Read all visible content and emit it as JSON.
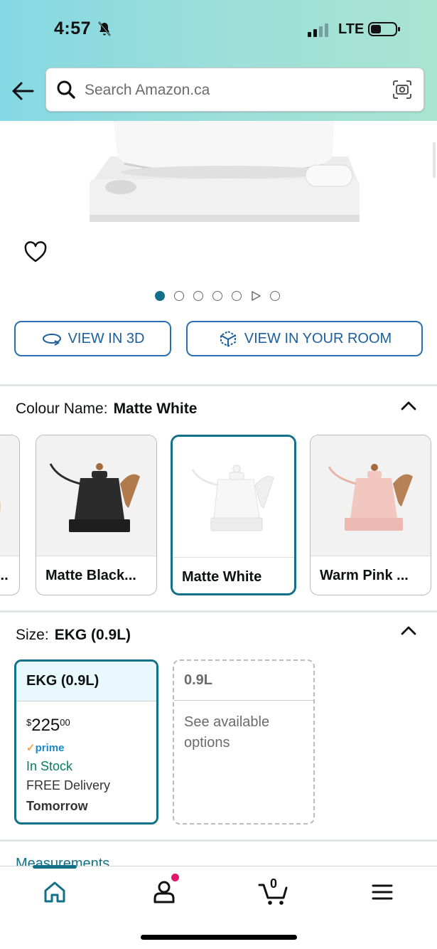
{
  "status_bar": {
    "time": "4:57",
    "network": "LTE"
  },
  "search": {
    "placeholder": "Search Amazon.ca"
  },
  "gallery": {
    "total_dots": 7,
    "active_index": 0
  },
  "buttons": {
    "view_3d": "VIEW IN 3D",
    "view_room": "VIEW IN YOUR ROOM"
  },
  "colour": {
    "label": "Colour Name:",
    "selected": "Matte White",
    "options": [
      {
        "label": "...",
        "color": "#e8e0d4"
      },
      {
        "label": "Matte Black...",
        "color": "#2b2b2b"
      },
      {
        "label": "Matte White",
        "color": "#f8f8f8"
      },
      {
        "label": "Warm Pink ...",
        "color": "#f2c7c0"
      }
    ]
  },
  "size": {
    "label": "Size:",
    "selected": "EKG (0.9L)",
    "options": [
      {
        "name": "EKG (0.9L)",
        "price_whole": "225",
        "price_symbol": "$",
        "price_fraction": "00",
        "prime": "prime",
        "stock": "In Stock",
        "delivery": "FREE Delivery",
        "delivery_day": "Tomorrow"
      },
      {
        "name": "0.9L",
        "note": "See available options"
      }
    ]
  },
  "measurements_label": "Measurements",
  "cart": {
    "count": "0"
  },
  "colors": {
    "accent": "#127088",
    "link": "#1b5e9c",
    "in_stock": "#067d62",
    "notif": "#e2196a"
  }
}
